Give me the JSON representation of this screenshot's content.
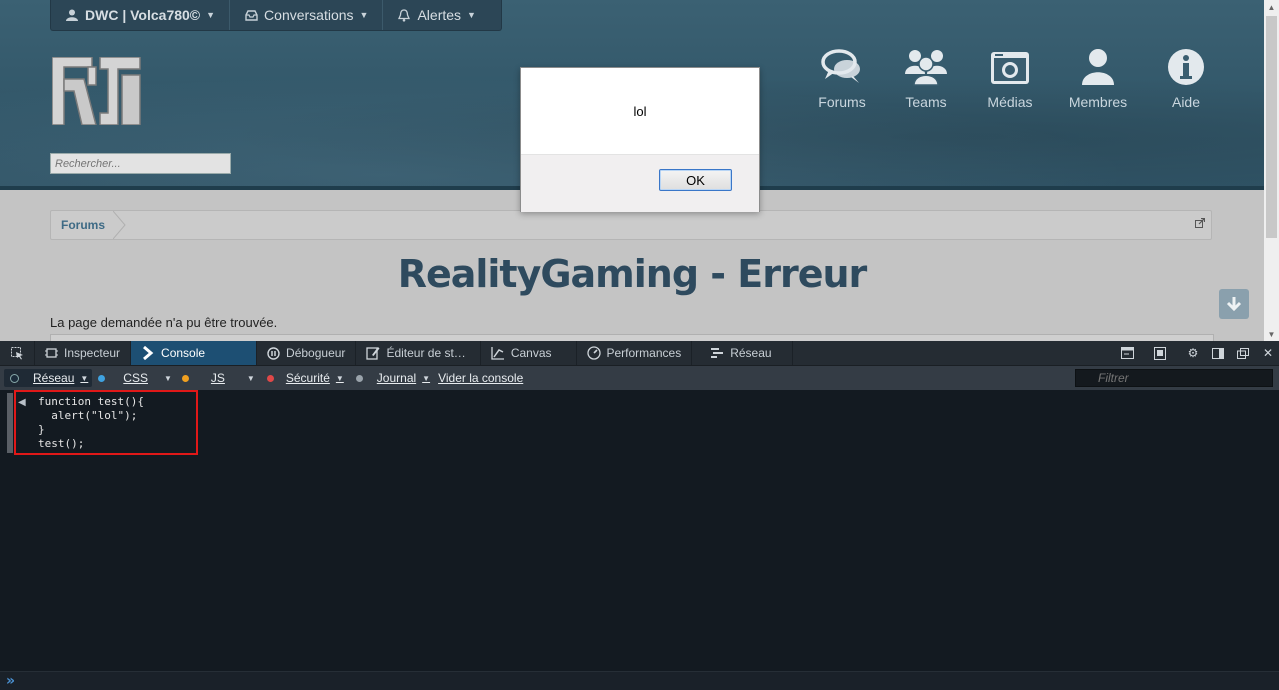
{
  "topbar": {
    "user": "DWC | Volca780©",
    "conversations": "Conversations",
    "alerts": "Alertes"
  },
  "search": {
    "placeholder": "Rechercher..."
  },
  "nav": {
    "items": [
      {
        "label": "Forums",
        "icon": "chat-bubbles-icon"
      },
      {
        "label": "Teams",
        "icon": "group-icon"
      },
      {
        "label": "Médias",
        "icon": "camera-icon"
      },
      {
        "label": "Membres",
        "icon": "user-icon"
      },
      {
        "label": "Aide",
        "icon": "info-icon"
      }
    ]
  },
  "breadcrumb": {
    "item": "Forums"
  },
  "page": {
    "title": "RealityGaming - Erreur",
    "message": "La page demandée n'a pu être trouvée."
  },
  "dialog": {
    "message": "lol",
    "ok_label": "OK"
  },
  "devtools": {
    "tabs": [
      {
        "label": "Inspecteur",
        "icon": "inspector-icon",
        "active": false
      },
      {
        "label": "Console",
        "icon": "console-icon",
        "active": true
      },
      {
        "label": "Débogueur",
        "icon": "debugger-icon",
        "active": false
      },
      {
        "label": "Éditeur de st…",
        "icon": "style-editor-icon",
        "active": false
      },
      {
        "label": "Canvas",
        "icon": "canvas-icon",
        "active": false
      },
      {
        "label": "Performances",
        "icon": "performance-icon",
        "active": false
      },
      {
        "label": "Réseau",
        "icon": "network-icon",
        "active": false
      }
    ],
    "filters": [
      {
        "label": "Réseau",
        "color": "#1b2b3a"
      },
      {
        "label": "CSS",
        "color": "#3fa2e0"
      },
      {
        "label": "JS",
        "color": "#f0a020"
      },
      {
        "label": "Sécurité",
        "color": "#e04848"
      },
      {
        "label": "Journal",
        "color": "#9aa3ab"
      }
    ],
    "clear_label": "Vider la console",
    "filter_placeholder": "Filtrer",
    "code_lines": [
      "function test(){",
      "  alert(\"lol\");",
      "}",
      "test();"
    ],
    "prompt": "»"
  },
  "colors": {
    "header": "#34596b",
    "title": "#2e4a5e",
    "active_tab": "#1d4f73",
    "highlight": "#e01818"
  }
}
